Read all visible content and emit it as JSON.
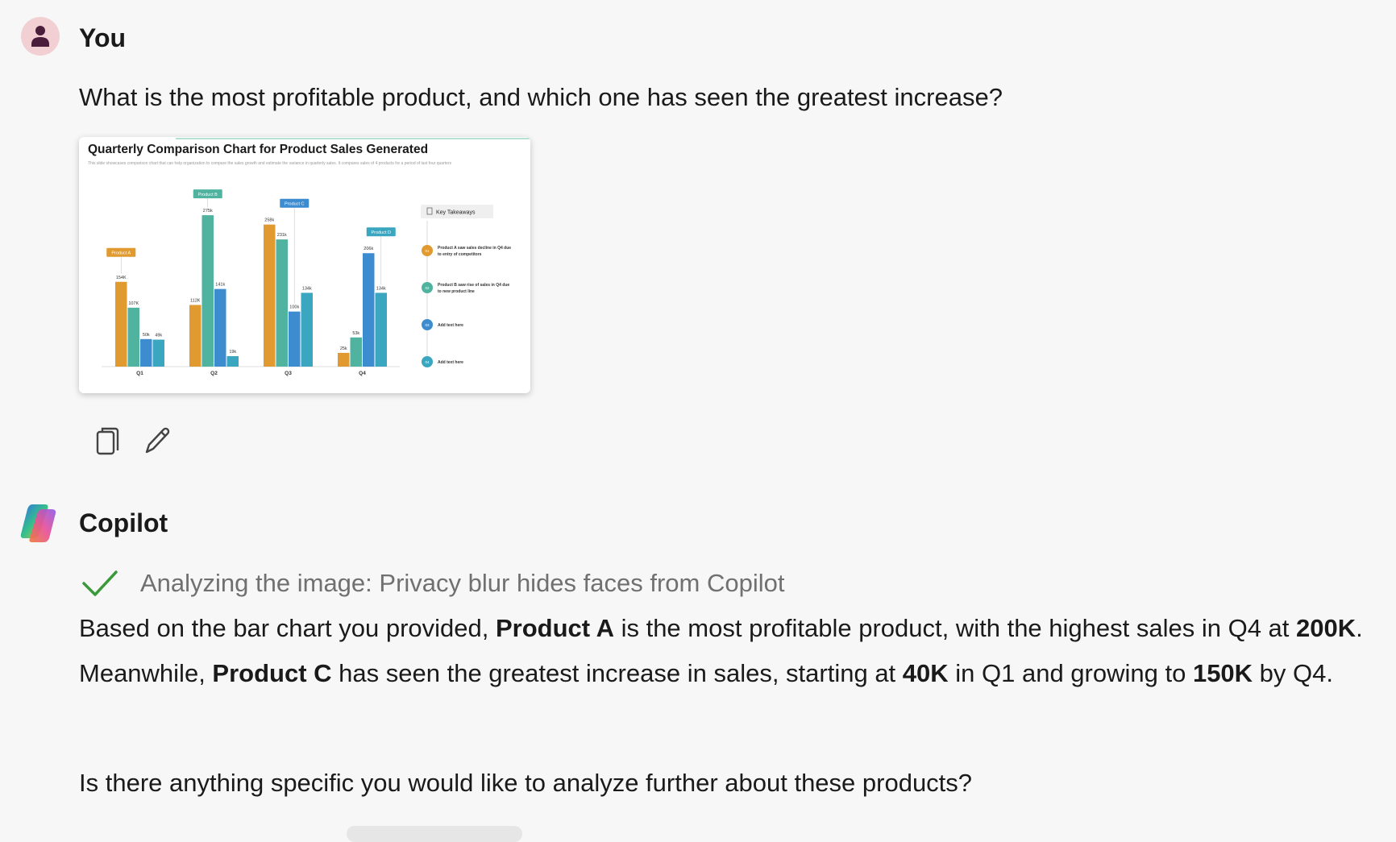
{
  "conversation": {
    "user": {
      "name": "You",
      "avatar_icon": "person-icon",
      "message": "What is the most profitable product, and which one has seen the greatest increase?",
      "attachment": {
        "title": "Quarterly Comparison Chart for Product Sales Generated",
        "subtitle": "This slide showcases comparison chart that can help organization to compare the sales growth and estimate the variance in quarterly sales. It compares sales of 4 products for a period of last four quarters"
      },
      "actions": [
        {
          "name": "copy",
          "icon": "copy-icon"
        },
        {
          "name": "edit",
          "icon": "pencil-icon"
        }
      ]
    },
    "assistant": {
      "name": "Copilot",
      "logo_icon": "copilot-logo-icon",
      "status": {
        "icon": "checkmark-icon",
        "text": "Analyzing the image: Privacy blur hides faces from Copilot",
        "color": "#3a9a3a"
      },
      "answer": {
        "p1": "Based on the bar chart you provided, ",
        "b1": "Product A",
        "p2": " is the most profitable product, with the highest sales in Q4 at ",
        "b2": "200K",
        "p3": ". Meanwhile, ",
        "b3": "Product C",
        "p4": " has seen the greatest increase in sales, starting at ",
        "b4": "40K",
        "p5": " in Q1 and growing to ",
        "b5": "150K",
        "p6": " by Q4."
      },
      "followup": "Is there anything specific you would like to analyze further about these products?"
    }
  },
  "chart_data": {
    "type": "bar",
    "title": "Quarterly Comparison Chart for Product Sales Generated",
    "categories": [
      "Q1",
      "Q2",
      "Q3",
      "Q4"
    ],
    "series": [
      {
        "name": "Product A",
        "color": "#e09a30",
        "values": [
          154,
          112,
          258,
          25
        ],
        "labels": [
          "154K",
          "112K",
          "258k",
          "25k"
        ]
      },
      {
        "name": "Product B",
        "color": "#4fb3a0",
        "values": [
          107,
          275,
          231,
          53
        ],
        "labels": [
          "107K",
          "275k",
          "231k",
          "53k"
        ]
      },
      {
        "name": "Product C",
        "color": "#3d8ccf",
        "values": [
          50,
          141,
          100,
          206
        ],
        "labels": [
          "50k",
          "141k",
          "100k",
          "206k"
        ]
      },
      {
        "name": "Product D",
        "color": "#3aa6bf",
        "values": [
          49,
          19,
          134,
          134
        ],
        "labels": [
          "49k",
          "19k",
          "134k",
          "134k"
        ]
      }
    ],
    "group_callouts": [
      {
        "text": "Product A",
        "category": "Q1",
        "color": "#e09a30"
      },
      {
        "text": "Product B",
        "category": "Q2",
        "color": "#4fb3a0"
      },
      {
        "text": "Product C",
        "category": "Q3",
        "color": "#3d8ccf"
      },
      {
        "text": "Product D",
        "category": "Q4",
        "color": "#3aa6bf"
      }
    ],
    "ylim": [
      0,
      300
    ],
    "grid": false,
    "key_takeaways": {
      "title": "Key Takeaways",
      "items": [
        {
          "num": "01",
          "color": "#e09a30",
          "text": "Product A saw sales decline in Q4 due to entry of competitors"
        },
        {
          "num": "02",
          "color": "#4fb3a0",
          "text": "Product B saw rise of sales in Q4 due to new product line"
        },
        {
          "num": "03",
          "color": "#3d8ccf",
          "text": "Add text here"
        },
        {
          "num": "04",
          "color": "#3aa6bf",
          "text": "Add text here"
        }
      ]
    }
  }
}
